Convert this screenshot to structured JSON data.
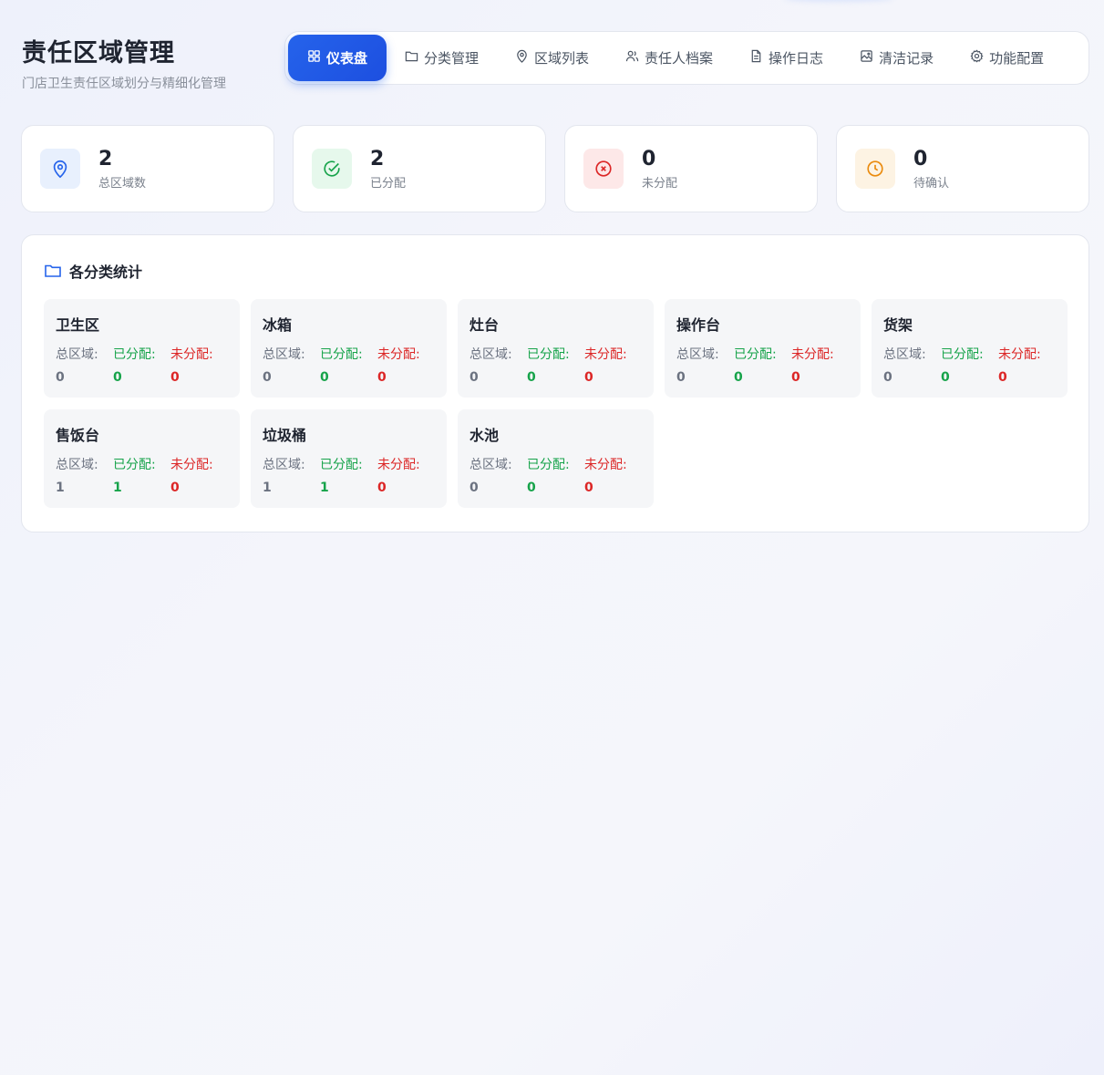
{
  "header": {
    "title": "责任区域管理",
    "subtitle": "门店卫生责任区域划分与精细化管理"
  },
  "nav": {
    "tabs": [
      {
        "label": "仪表盘",
        "icon": "dashboard-icon",
        "active": true
      },
      {
        "label": "分类管理",
        "icon": "folder-icon"
      },
      {
        "label": "区域列表",
        "icon": "map-pin-icon"
      },
      {
        "label": "责任人档案",
        "icon": "users-icon"
      },
      {
        "label": "操作日志",
        "icon": "file-text-icon"
      },
      {
        "label": "清洁记录",
        "icon": "image-icon"
      },
      {
        "label": "功能配置",
        "icon": "gear-icon"
      }
    ]
  },
  "stats": [
    {
      "value": "2",
      "label": "总区域数",
      "icon": "map-pin-icon",
      "color": "#2563eb",
      "bg": "#e8f0fd"
    },
    {
      "value": "2",
      "label": "已分配",
      "icon": "check-circle-icon",
      "color": "#16a34a",
      "bg": "#e6f8ec"
    },
    {
      "value": "0",
      "label": "未分配",
      "icon": "x-circle-icon",
      "color": "#dc2626",
      "bg": "#fde8e8"
    },
    {
      "value": "0",
      "label": "待确认",
      "icon": "clock-icon",
      "color": "#ea8a0c",
      "bg": "#fdf3e3"
    }
  ],
  "category_panel": {
    "title": "各分类统计",
    "labels": {
      "total": "总区域:",
      "assigned": "已分配:",
      "unassigned": "未分配:"
    },
    "categories": [
      {
        "name": "卫生区",
        "total": "0",
        "assigned": "0",
        "unassigned": "0"
      },
      {
        "name": "冰箱",
        "total": "0",
        "assigned": "0",
        "unassigned": "0"
      },
      {
        "name": "灶台",
        "total": "0",
        "assigned": "0",
        "unassigned": "0"
      },
      {
        "name": "操作台",
        "total": "0",
        "assigned": "0",
        "unassigned": "0"
      },
      {
        "name": "货架",
        "total": "0",
        "assigned": "0",
        "unassigned": "0"
      },
      {
        "name": "售饭台",
        "total": "1",
        "assigned": "1",
        "unassigned": "0"
      },
      {
        "name": "垃圾桶",
        "total": "1",
        "assigned": "1",
        "unassigned": "0"
      },
      {
        "name": "水池",
        "total": "0",
        "assigned": "0",
        "unassigned": "0"
      }
    ]
  },
  "colors": {
    "accent": "#2563eb",
    "assigned": "#16a34a",
    "unassigned": "#dc2626"
  }
}
